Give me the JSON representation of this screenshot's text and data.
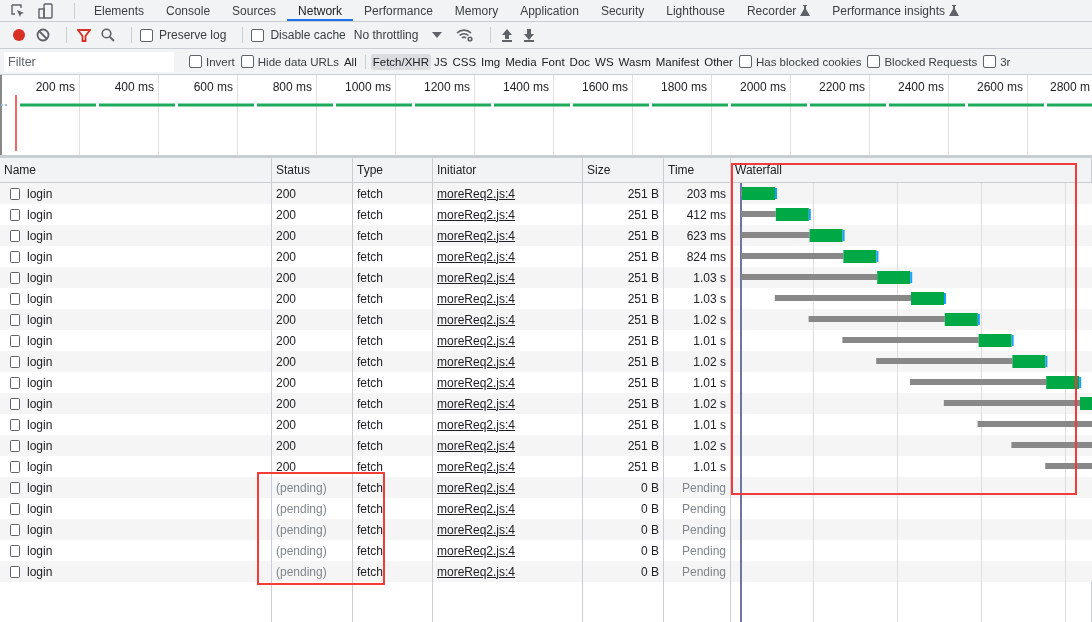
{
  "tabs": [
    {
      "label": "Elements",
      "selected": false
    },
    {
      "label": "Console",
      "selected": false
    },
    {
      "label": "Sources",
      "selected": false
    },
    {
      "label": "Network",
      "selected": true
    },
    {
      "label": "Performance",
      "selected": false
    },
    {
      "label": "Memory",
      "selected": false
    },
    {
      "label": "Application",
      "selected": false
    },
    {
      "label": "Security",
      "selected": false
    },
    {
      "label": "Lighthouse",
      "selected": false
    },
    {
      "label": "Recorder",
      "selected": false,
      "experimental": true
    },
    {
      "label": "Performance insights",
      "selected": false,
      "experimental": true
    }
  ],
  "toolbar": {
    "recording": true,
    "filter_active": true,
    "preserve_log": {
      "label": "Preserve log",
      "checked": false
    },
    "disable_cache": {
      "label": "Disable cache",
      "checked": false
    },
    "throttling": "No throttling"
  },
  "filter_bar": {
    "placeholder": "Filter",
    "checkboxes_before": [
      {
        "label": "Invert",
        "checked": false
      },
      {
        "label": "Hide data URLs",
        "checked": false
      }
    ],
    "types": [
      {
        "label": "All",
        "selected": false
      },
      {
        "label": "Fetch/XHR",
        "selected": true
      },
      {
        "label": "JS",
        "selected": false
      },
      {
        "label": "CSS",
        "selected": false
      },
      {
        "label": "Img",
        "selected": false
      },
      {
        "label": "Media",
        "selected": false
      },
      {
        "label": "Font",
        "selected": false
      },
      {
        "label": "Doc",
        "selected": false
      },
      {
        "label": "WS",
        "selected": false
      },
      {
        "label": "Wasm",
        "selected": false
      },
      {
        "label": "Manifest",
        "selected": false
      },
      {
        "label": "Other",
        "selected": false
      }
    ],
    "checkboxes_after": [
      {
        "label": "Has blocked cookies",
        "checked": false
      },
      {
        "label": "Blocked Requests",
        "checked": false
      },
      {
        "label": "3r",
        "checked": false
      }
    ]
  },
  "overview": {
    "ticks": [
      "200 ms",
      "400 ms",
      "600 ms",
      "800 ms",
      "1000 ms",
      "1200 ms",
      "1400 ms",
      "1600 ms",
      "1800 ms",
      "2000 ms",
      "2200 ms",
      "2400 ms",
      "2600 ms",
      "2800 m"
    ]
  },
  "table": {
    "columns": [
      "Name",
      "Status",
      "Type",
      "Initiator",
      "Size",
      "Time",
      "Waterfall"
    ],
    "rows": [
      {
        "name": "login",
        "status": "200",
        "type": "fetch",
        "initiator": "moreReq2.js:4",
        "size": "251 B",
        "time": "203 ms",
        "pending": false
      },
      {
        "name": "login",
        "status": "200",
        "type": "fetch",
        "initiator": "moreReq2.js:4",
        "size": "251 B",
        "time": "412 ms",
        "pending": false
      },
      {
        "name": "login",
        "status": "200",
        "type": "fetch",
        "initiator": "moreReq2.js:4",
        "size": "251 B",
        "time": "623 ms",
        "pending": false
      },
      {
        "name": "login",
        "status": "200",
        "type": "fetch",
        "initiator": "moreReq2.js:4",
        "size": "251 B",
        "time": "824 ms",
        "pending": false
      },
      {
        "name": "login",
        "status": "200",
        "type": "fetch",
        "initiator": "moreReq2.js:4",
        "size": "251 B",
        "time": "1.03 s",
        "pending": false
      },
      {
        "name": "login",
        "status": "200",
        "type": "fetch",
        "initiator": "moreReq2.js:4",
        "size": "251 B",
        "time": "1.03 s",
        "pending": false
      },
      {
        "name": "login",
        "status": "200",
        "type": "fetch",
        "initiator": "moreReq2.js:4",
        "size": "251 B",
        "time": "1.02 s",
        "pending": false
      },
      {
        "name": "login",
        "status": "200",
        "type": "fetch",
        "initiator": "moreReq2.js:4",
        "size": "251 B",
        "time": "1.01 s",
        "pending": false
      },
      {
        "name": "login",
        "status": "200",
        "type": "fetch",
        "initiator": "moreReq2.js:4",
        "size": "251 B",
        "time": "1.02 s",
        "pending": false
      },
      {
        "name": "login",
        "status": "200",
        "type": "fetch",
        "initiator": "moreReq2.js:4",
        "size": "251 B",
        "time": "1.01 s",
        "pending": false
      },
      {
        "name": "login",
        "status": "200",
        "type": "fetch",
        "initiator": "moreReq2.js:4",
        "size": "251 B",
        "time": "1.02 s",
        "pending": false
      },
      {
        "name": "login",
        "status": "200",
        "type": "fetch",
        "initiator": "moreReq2.js:4",
        "size": "251 B",
        "time": "1.01 s",
        "pending": false
      },
      {
        "name": "login",
        "status": "200",
        "type": "fetch",
        "initiator": "moreReq2.js:4",
        "size": "251 B",
        "time": "1.02 s",
        "pending": false
      },
      {
        "name": "login",
        "status": "200",
        "type": "fetch",
        "initiator": "moreReq2.js:4",
        "size": "251 B",
        "time": "1.01 s",
        "pending": false
      },
      {
        "name": "login",
        "status": "(pending)",
        "type": "fetch",
        "initiator": "moreReq2.js:4",
        "size": "0 B",
        "time": "Pending",
        "pending": true
      },
      {
        "name": "login",
        "status": "(pending)",
        "type": "fetch",
        "initiator": "moreReq2.js:4",
        "size": "0 B",
        "time": "Pending",
        "pending": true
      },
      {
        "name": "login",
        "status": "(pending)",
        "type": "fetch",
        "initiator": "moreReq2.js:4",
        "size": "0 B",
        "time": "Pending",
        "pending": true
      },
      {
        "name": "login",
        "status": "(pending)",
        "type": "fetch",
        "initiator": "moreReq2.js:4",
        "size": "0 B",
        "time": "Pending",
        "pending": true
      },
      {
        "name": "login",
        "status": "(pending)",
        "type": "fetch",
        "initiator": "moreReq2.js:4",
        "size": "0 B",
        "time": "Pending",
        "pending": true
      }
    ],
    "waterfall_highlighted": true,
    "pending_highlighted": true
  }
}
